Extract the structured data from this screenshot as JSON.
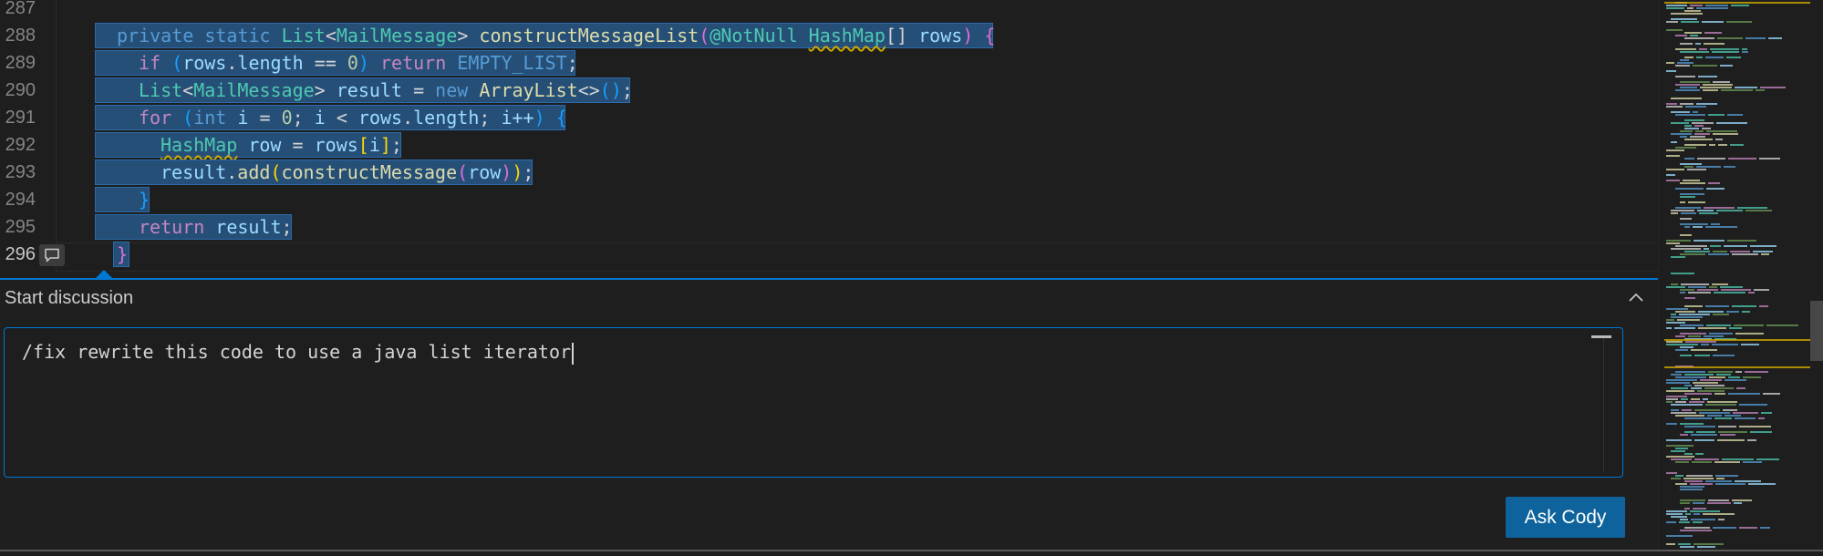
{
  "editor": {
    "lines": [
      {
        "number": "287"
      },
      {
        "number": "288"
      },
      {
        "number": "289"
      },
      {
        "number": "290"
      },
      {
        "number": "291"
      },
      {
        "number": "292"
      },
      {
        "number": "293"
      },
      {
        "number": "294"
      },
      {
        "number": "295"
      },
      {
        "number": "296"
      }
    ],
    "code": {
      "l288": {
        "private": "private",
        "static": "static",
        "list": "List",
        "lt": "<",
        "mailmessage": "MailMessage",
        "gt": ">",
        "method": "constructMessageList",
        "lparen": "(",
        "at": "@",
        "notnull": "NotNull",
        "hashmap": "HashMap",
        "arr": "[]",
        "rows": "rows",
        "rparen": ")",
        "lbrace": "{"
      },
      "l289": {
        "if": "if",
        "lparen": "(",
        "rows": "rows",
        "dot": ".",
        "length": "length",
        "eq": "==",
        "zero": "0",
        "rparen": ")",
        "return": "return",
        "empty": "EMPTY_LIST",
        "semi": ";"
      },
      "l290": {
        "list": "List",
        "lt": "<",
        "mailmessage": "MailMessage",
        "gt": ">",
        "result": "result",
        "assign": "=",
        "new": "new",
        "arraylist": "ArrayList",
        "diamond": "<>",
        "parens": "()",
        "semi": ";"
      },
      "l291": {
        "for": "for",
        "lparen": "(",
        "int": "int",
        "i": "i",
        "assign": "=",
        "zero": "0",
        "semi1": ";",
        "i2": "i",
        "lt": "<",
        "rows": "rows",
        "dot": ".",
        "length": "length",
        "semi2": ";",
        "iinc": "i++",
        "rparen": ")",
        "lbrace": "{"
      },
      "l292": {
        "hashmap": "HashMap",
        "row": "row",
        "assign": "=",
        "rows": "rows",
        "lbr": "[",
        "i": "i",
        "rbr": "]",
        "semi": ";"
      },
      "l293": {
        "result": "result",
        "dot": ".",
        "add": "add",
        "lparen": "(",
        "construct": "constructMessage",
        "lparen2": "(",
        "row": "row",
        "rparen2": ")",
        "rparen": ")",
        "semi": ";"
      },
      "l294": {
        "rbrace": "}"
      },
      "l295": {
        "return": "return",
        "result": "result",
        "semi": ";"
      },
      "l296": {
        "rbrace": "}"
      }
    }
  },
  "panel": {
    "title": "Start discussion",
    "input_value": "/fix rewrite this code to use a java list iterator",
    "ask_button": "Ask Cody"
  },
  "icons": {
    "comment": "comment-icon",
    "collapse": "chevron-up-icon"
  },
  "colors": {
    "accent": "#0078d4",
    "button": "#0e639c",
    "selection": "#264f78"
  }
}
